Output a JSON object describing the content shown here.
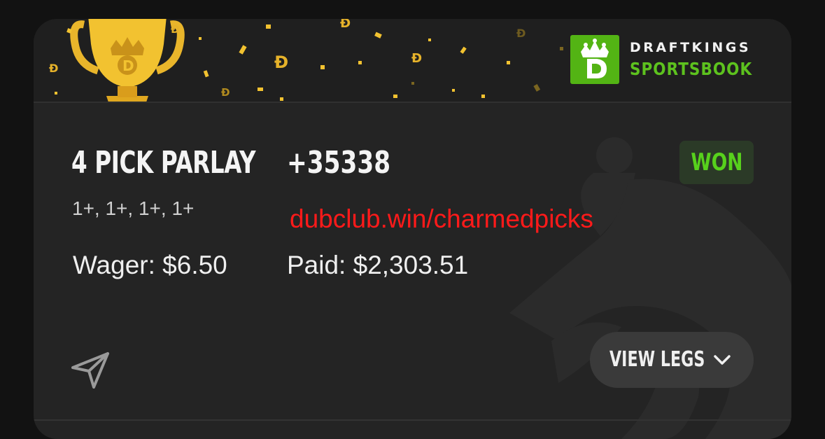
{
  "brand": {
    "line1": "DRAFTKINGS",
    "line2": "SPORTSBOOK",
    "accent": "#53b414",
    "icon": "draftkings-crown-logo-icon"
  },
  "banner": {
    "icon": "trophy-icon",
    "confetti_color": "#f2c230"
  },
  "bet": {
    "title": "4 PICK PARLAY",
    "odds": "+35338",
    "status": "WON",
    "status_color": "#57d11c",
    "legs_summary": "1+, 1+, 1+, 1+",
    "promo_text": "dubclub.win/charmedpicks",
    "wager": "Wager: $6.50",
    "paid": "Paid: $2,303.51"
  },
  "actions": {
    "share_icon": "share-paper-plane-icon",
    "view_legs_label": "VIEW LEGS",
    "view_legs_icon": "chevron-down-icon"
  }
}
